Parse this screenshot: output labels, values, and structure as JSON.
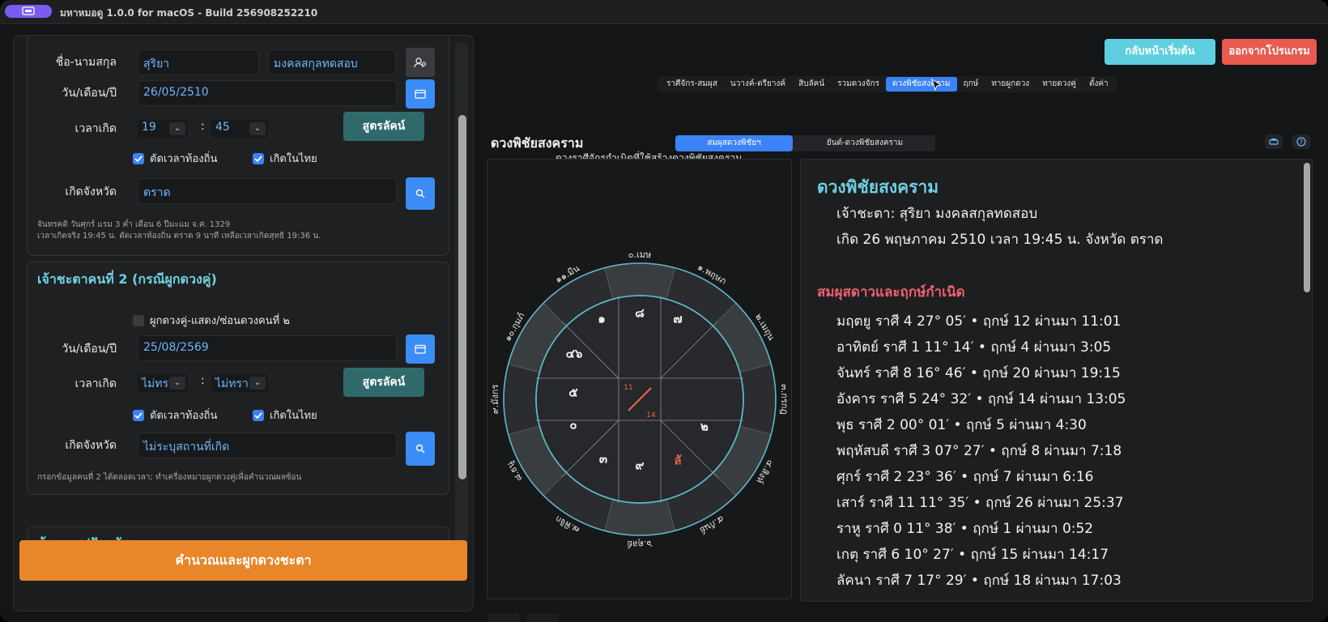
{
  "window": {
    "title": "มหาหมอดู 1.0.0 for macOS - Build 256908252210"
  },
  "person1": {
    "name_label": "ชื่อ-นามสกุล",
    "first_name": "สุริยา",
    "last_name": "มงคลสกุลทดสอบ",
    "date_label": "วัน/เดือน/ปี",
    "date_value": "26/05/2510",
    "time_label": "เวลาเกิด",
    "hour": "19",
    "minute": "45",
    "colon": ":",
    "sutra_button": "สูตรลัคน์",
    "cb_local_time": "ตัดเวลาท้องถิ่น",
    "cb_born_thai": "เกิดในไทย",
    "province_label": "เกิดจังหวัด",
    "province_value": "ตราด",
    "note_line1": "จันทรคติ วันศุกร์ แรม 3 ค่ำ เดือน 6 ปีมะแม จ.ศ. 1329",
    "note_line2": "เวลาเกิดจริง 19:45 น. ตัดเวลาท้องถิ่น ตราด 9 นาที เหลือเวลาเกิดสุทธิ 19:36 น."
  },
  "person2": {
    "title": "เจ้าชะตาคนที่ 2 (กรณีผูกดวงคู่)",
    "cb_toggle": "ผูกดวงคู่-แสดง/ซ่อนดวงคนที่ ๒",
    "date_label": "วัน/เดือน/ปี",
    "date_value": "25/08/2569",
    "time_label": "เวลาเกิด",
    "hour": "ไม่ทรา",
    "minute": "ไม่ทรา",
    "colon": ":",
    "sutra_button": "สูตรลัคน์",
    "cb_local_time": "ตัดเวลาท้องถิ่น",
    "cb_born_thai": "เกิดในไทย",
    "province_label": "เกิดจังหวัด",
    "province_value": "ไม่ระบุสถานที่เกิด",
    "note": "กรอกข้อมูลคนที่ 2 ได้ตลอดเวลา; ทำเครื่องหมายผูกดวงคู่เพื่อคำนวณผลซ้อน"
  },
  "current_section": {
    "title": "ข้อมูลจร/ปัจจุบัน"
  },
  "calc_button": "คำนวณและผูกดวงชะตา",
  "top_buttons": {
    "home": "กลับหน้าเริ่มต้น",
    "exit": "ออกจากโปรแกรม"
  },
  "tabs": [
    {
      "label": "ราศีจักร-สมผุส",
      "active": false
    },
    {
      "label": "นวางค์-ตรียางค์",
      "active": false
    },
    {
      "label": "สิบลัคน์",
      "active": false
    },
    {
      "label": "รวมดวงจักร",
      "active": false
    },
    {
      "label": "ดวงพิชัยสงคราม",
      "active": true
    },
    {
      "label": "ฤกษ์",
      "active": false
    },
    {
      "label": "ทายผูกดวง",
      "active": false
    },
    {
      "label": "ทายดวงคู่",
      "active": false
    },
    {
      "label": "ตั้งค่า",
      "active": false
    }
  ],
  "section": {
    "title": "ดวงพิชัยสงคราม",
    "subtab_active": "สมผุสดวงพิชัยฯ",
    "subtab_other": "ยันต์-ดวงพิชัยสงคราม",
    "chart_caption": "ดวงราศีจักรกำเนิดที่ใช้สร้างดวงพิชัยสงคราม"
  },
  "wheel": {
    "signs": [
      "๐.เมษ",
      "๑๑.มีน",
      "๑๐.กุมภ์",
      "๙.มังกร",
      "๘.ธนู",
      "๗.พิจิก",
      "๖.ตุลย์",
      "๕.กันย์",
      "๔.สิงห์",
      "๓.กรกฎ",
      "๒.เมถุน",
      "๑.พฤษภ"
    ],
    "cells": [
      "๘",
      "๗",
      "๑",
      "๔๖",
      "๕",
      "๐",
      "๒",
      "๓",
      "๙",
      "ลั"
    ],
    "center_top": "11",
    "center_bottom": "14",
    "accent": "#e8654a",
    "ring_color": "#5fb8c8"
  },
  "report": {
    "title": "ดวงพิชัยสงคราม",
    "owner": "เจ้าชะตา: สุริยา มงคลสกุลทดสอบ",
    "born": "เกิด 26 พฤษภาคม 2510 เวลา 19:45 น. จังหวัด ตราด",
    "sub_title": "สมผุสดาวและฤกษ์กำเนิด",
    "rows": [
      "มฤตยู  ราศี 4  27° 05′  • ฤกษ์ 12 ผ่านมา 11:01",
      "อาทิตย์  ราศี 1  11° 14′  • ฤกษ์ 4 ผ่านมา 3:05",
      "จันทร์  ราศี 8  16° 46′  • ฤกษ์ 20 ผ่านมา 19:15",
      "อังคาร  ราศี 5  24° 32′  • ฤกษ์ 14 ผ่านมา 13:05",
      "พุธ  ราศี 2  00° 01′  • ฤกษ์ 5 ผ่านมา 4:30",
      "พฤหัสบดี  ราศี 3  07° 27′  • ฤกษ์ 8 ผ่านมา 7:18",
      "ศุกร์  ราศี 2  23° 36′  • ฤกษ์ 7 ผ่านมา 6:16",
      "เสาร์  ราศี 11  11° 35′  • ฤกษ์ 26 ผ่านมา 25:37",
      "ราหู  ราศี 0  11° 38′  • ฤกษ์ 1 ผ่านมา 0:52",
      "เกตุ  ราศี 6  10° 27′  • ฤกษ์ 15 ผ่านมา 14:17",
      "ลัคนา  ราศี 7  17° 29′  • ฤกษ์ 18 ผ่านมา 17:03"
    ]
  }
}
